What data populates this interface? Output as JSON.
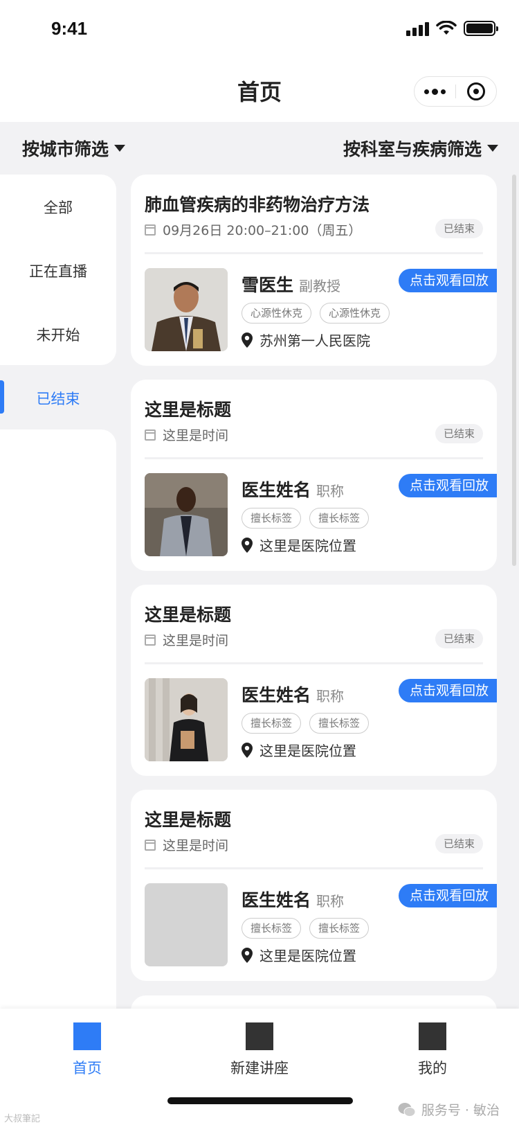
{
  "status_bar": {
    "time": "9:41"
  },
  "nav": {
    "title": "首页"
  },
  "filters": {
    "city": "按城市筛选",
    "department": "按科室与疾病筛选"
  },
  "sidebar": {
    "items": [
      {
        "label": "全部"
      },
      {
        "label": "正在直播"
      },
      {
        "label": "未开始"
      },
      {
        "label": "已结束",
        "active": true
      }
    ]
  },
  "cards": [
    {
      "title": "肺血管疾病的非药物治疗方法",
      "time": "09月26日 20:00–21:00（周五）",
      "status": "已结束",
      "doctor_name": "雪医生",
      "doctor_title": "副教授",
      "action": "点击观看回放",
      "tags": [
        "心源性休克",
        "心源性休克"
      ],
      "hospital": "苏州第一人民医院"
    },
    {
      "title": "这里是标题",
      "time": "这里是时间",
      "status": "已结束",
      "doctor_name": "医生姓名",
      "doctor_title": "职称",
      "action": "点击观看回放",
      "tags": [
        "擅长标签",
        "擅长标签"
      ],
      "hospital": "这里是医院位置"
    },
    {
      "title": "这里是标题",
      "time": "这里是时间",
      "status": "已结束",
      "doctor_name": "医生姓名",
      "doctor_title": "职称",
      "action": "点击观看回放",
      "tags": [
        "擅长标签",
        "擅长标签"
      ],
      "hospital": "这里是医院位置"
    },
    {
      "title": "这里是标题",
      "time": "这里是时间",
      "status": "已结束",
      "doctor_name": "医生姓名",
      "doctor_title": "职称",
      "action": "点击观看回放",
      "tags": [
        "擅长标签",
        "擅长标签"
      ],
      "hospital": "这里是医院位置"
    }
  ],
  "tabbar": {
    "items": [
      {
        "label": "首页",
        "active": true
      },
      {
        "label": "新建讲座"
      },
      {
        "label": "我的"
      }
    ]
  },
  "watermark": {
    "text": "服务号 · 敏治",
    "corner": "大叔筆記"
  },
  "colors": {
    "accent": "#2e7cf6",
    "background": "#f2f2f4",
    "card": "#ffffff"
  }
}
